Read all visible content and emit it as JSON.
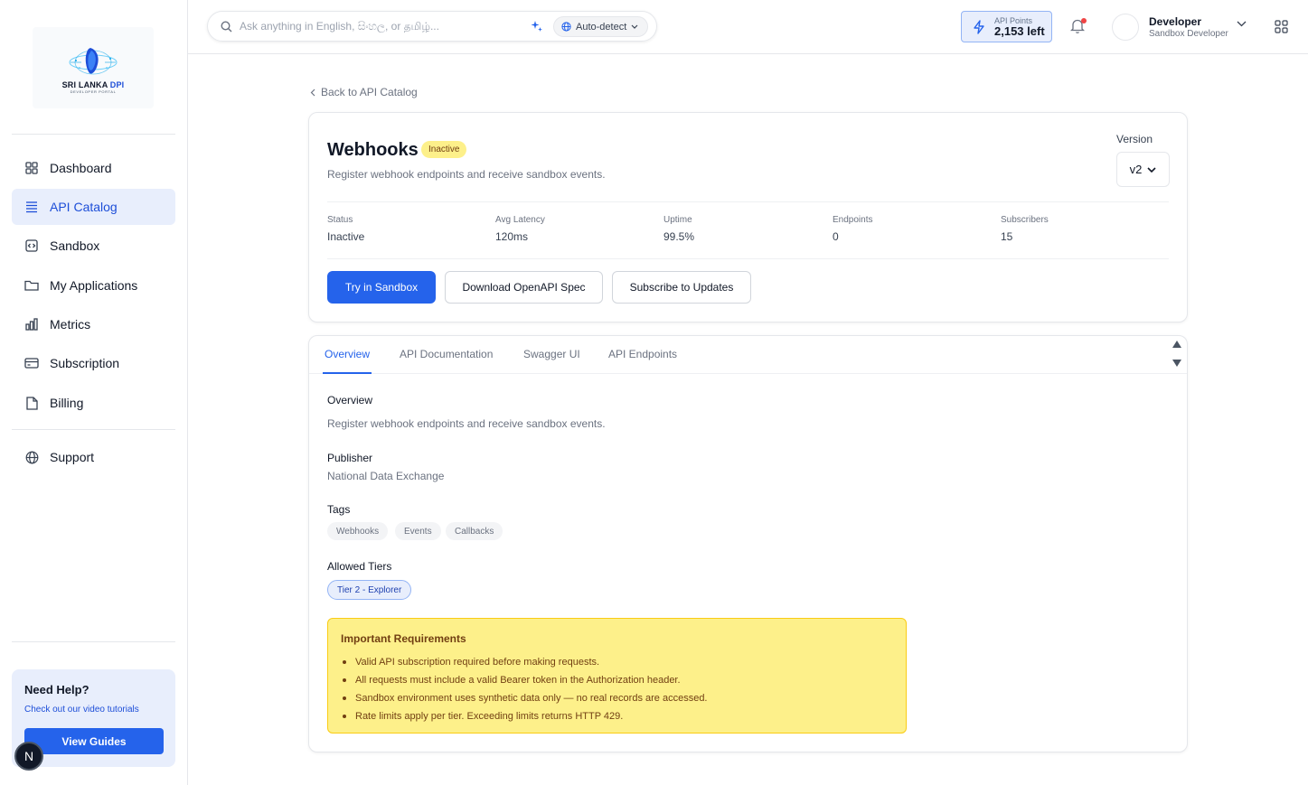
{
  "brand": {
    "logo_title_main": "SRI LANKA",
    "logo_title_accent": "DPI",
    "logo_subtitle": "DEVELOPER PORTAL"
  },
  "sidebar": {
    "items": [
      {
        "label": "Dashboard",
        "icon": "grid-icon"
      },
      {
        "label": "API Catalog",
        "icon": "list-icon",
        "active": true
      },
      {
        "label": "Sandbox",
        "icon": "code-box-icon"
      },
      {
        "label": "My Applications",
        "icon": "folder-icon"
      },
      {
        "label": "Metrics",
        "icon": "bar-chart-icon"
      },
      {
        "label": "Subscription",
        "icon": "credit-card-icon"
      },
      {
        "label": "Billing",
        "icon": "document-icon"
      },
      {
        "label": "Support",
        "icon": "globe-icon"
      }
    ],
    "help": {
      "title": "Need Help?",
      "subtitle": "Check out our video tutorials",
      "button": "View Guides"
    },
    "badge": "N"
  },
  "header": {
    "search_placeholder": "Ask anything in English, සිංහල, or தமிழ்...",
    "language": "Auto-detect",
    "points_label": "API Points",
    "points_value": "2,153 left",
    "user_name": "Developer",
    "user_role": "Sandbox Developer"
  },
  "main": {
    "back_link": "Back to API Catalog",
    "api": {
      "title": "Webhooks",
      "status_badge": "Inactive",
      "description": "Register webhook endpoints and receive sandbox events.",
      "version_label": "Version",
      "version_value": "v2"
    },
    "stats": [
      {
        "label": "Status",
        "value": "Inactive"
      },
      {
        "label": "Avg Latency",
        "value": "120ms"
      },
      {
        "label": "Uptime",
        "value": "99.5%"
      },
      {
        "label": "Endpoints",
        "value": "0"
      },
      {
        "label": "Subscribers",
        "value": "15"
      }
    ],
    "actions": {
      "try": "Try in Sandbox",
      "download": "Download OpenAPI Spec",
      "subscribe": "Subscribe to Updates"
    },
    "tabs": [
      "Overview",
      "API Documentation",
      "Swagger UI",
      "API Endpoints"
    ],
    "overview": {
      "heading": "Overview",
      "text": "Register webhook endpoints and receive sandbox events.",
      "publisher_heading": "Publisher",
      "publisher": "National Data Exchange",
      "tags_heading": "Tags",
      "tags": [
        "Webhooks",
        "Events",
        "Callbacks"
      ],
      "tiers_heading": "Allowed Tiers",
      "tier": "Tier 2 - Explorer",
      "requirements_title": "Important Requirements",
      "requirements": [
        "Valid API subscription required before making requests.",
        "All requests must include a valid Bearer token in the Authorization header.",
        "Sandbox environment uses synthetic data only — no real records are accessed.",
        "Rate limits apply per tier. Exceeding limits returns HTTP 429."
      ]
    }
  },
  "colors": {
    "accent": "#2563eb",
    "active_bg": "#e8eefc",
    "warning_bg": "#fdf08a",
    "warning_text": "#713f12"
  }
}
